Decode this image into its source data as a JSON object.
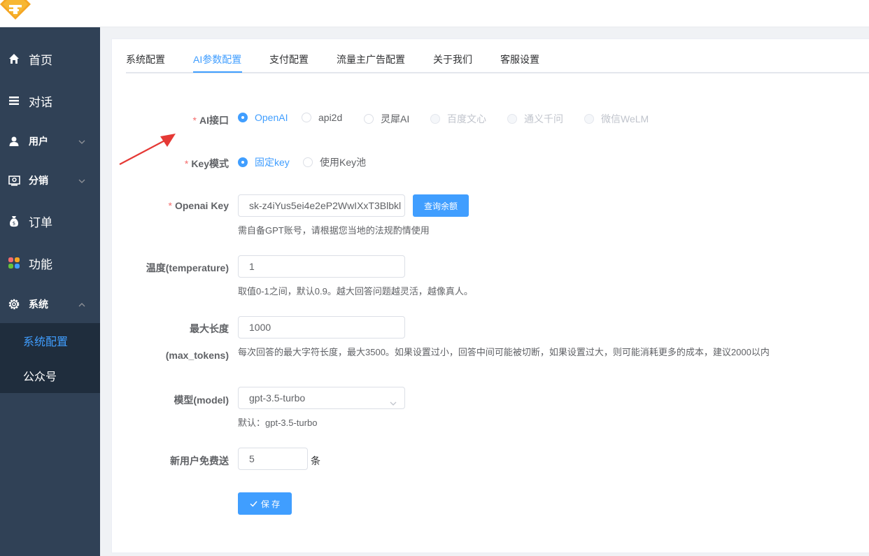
{
  "sidebar": {
    "items": [
      {
        "label": "首页",
        "icon": "home-icon"
      },
      {
        "label": "对话",
        "icon": "list-icon"
      },
      {
        "label": "用户",
        "icon": "user-icon"
      },
      {
        "label": "分销",
        "icon": "distribution-icon"
      },
      {
        "label": "订单",
        "icon": "money-bag-icon"
      },
      {
        "label": "功能",
        "icon": "apps-icon"
      },
      {
        "label": "系统",
        "icon": "gear-icon"
      }
    ],
    "sub_items": [
      {
        "label": "系统配置",
        "active": true
      },
      {
        "label": "公众号",
        "active": false
      }
    ]
  },
  "tabs": [
    {
      "label": "系统配置"
    },
    {
      "label": "AI参数配置",
      "active": true
    },
    {
      "label": "支付配置"
    },
    {
      "label": "流量主广告配置"
    },
    {
      "label": "关于我们"
    },
    {
      "label": "客服设置"
    }
  ],
  "form": {
    "ai_api": {
      "label": "AI接口",
      "options": [
        "OpenAI",
        "api2d",
        "灵犀AI",
        "百度文心",
        "通义千问",
        "微信WeLM"
      ],
      "selected": "OpenAI"
    },
    "key_mode": {
      "label": "Key模式",
      "options": [
        "固定key",
        "使用Key池"
      ],
      "selected": "固定key"
    },
    "openai_key": {
      "label": "Openai Key",
      "value": "sk-z4iYus5ei4e2eP2WwIXxT3Blbkl",
      "button": "查询余额",
      "hint": "需自备GPT账号，请根据您当地的法规酌情使用"
    },
    "temperature": {
      "label": "温度(temperature)",
      "value": "1",
      "hint": "取值0-1之间，默认0.9。越大回答问题越灵活，越像真人。"
    },
    "max_tokens": {
      "label_line1": "最大长度",
      "label_line2": "(max_tokens)",
      "value": "1000",
      "hint": "每次回答的最大字符长度，最大3500。如果设置过小，回答中间可能被切断，如果设置过大，则可能消耗更多的成本，建议2000以内"
    },
    "model": {
      "label": "模型(model)",
      "value": "gpt-3.5-turbo",
      "hint": "默认：gpt-3.5-turbo"
    },
    "free_gift": {
      "label": "新用户免费送",
      "value": "5",
      "unit": "条"
    },
    "save_label": "保 存"
  },
  "colors": {
    "primary": "#409eff",
    "sidebar_bg": "#304156",
    "submenu_bg": "#1f2d3d",
    "required": "#f56c6c",
    "annotation_arrow": "#e53935",
    "logo": "#f5a623"
  }
}
